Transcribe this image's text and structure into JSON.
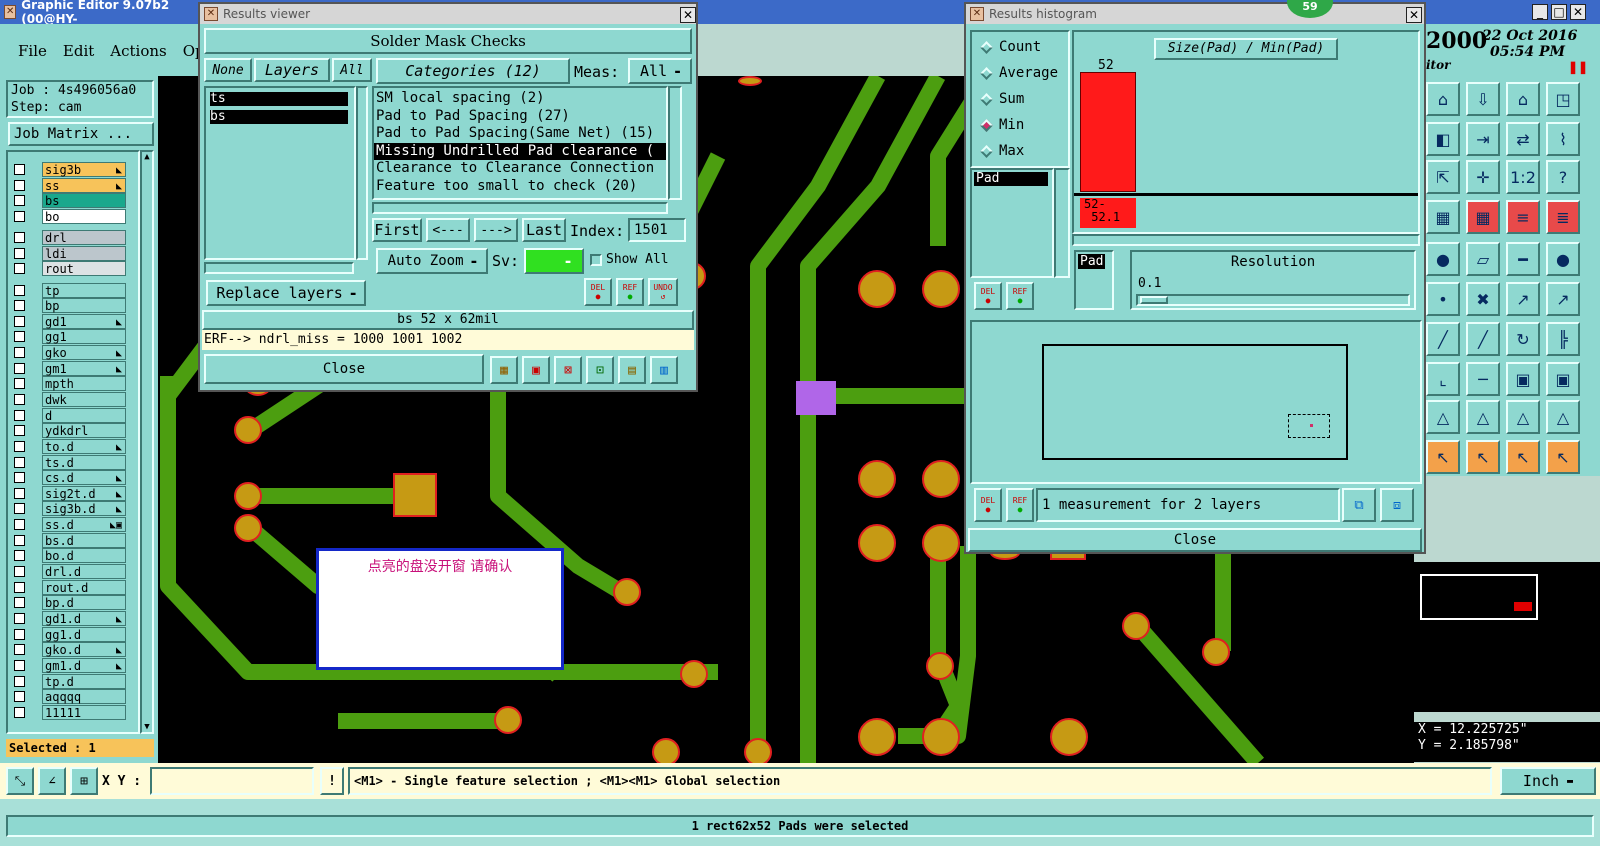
{
  "app": {
    "title": "Graphic Editor 9.07b2 (00@HY-",
    "menu": [
      "File",
      "Edit",
      "Actions",
      "Optio"
    ],
    "date_year": "2000",
    "date": "22 Oct 2016",
    "time": "05:54 PM",
    "date_sub": "itor",
    "badge": "59"
  },
  "job": {
    "job": "Job : 4s496056a0",
    "step": "Step: cam",
    "matrix_btn": "Job Matrix ...",
    "selected": "Selected : 1"
  },
  "layers": [
    {
      "name": "sig3b",
      "color": "#f7c35a",
      "mark": "◣"
    },
    {
      "name": "ss",
      "color": "#f7c35a",
      "mark": "◣"
    },
    {
      "name": "bs",
      "color": "#1aa88c",
      "mark": ""
    },
    {
      "name": "bo",
      "color": "#ffffff",
      "mark": ""
    },
    {
      "name": "drl",
      "color": "#bcc6cc",
      "mark": ""
    },
    {
      "name": "ldi",
      "color": "#bcc6cc",
      "mark": ""
    },
    {
      "name": "rout",
      "color": "#dde2e4",
      "mark": ""
    },
    {
      "name": "tp",
      "color": "#8ed8d0",
      "mark": ""
    },
    {
      "name": "bp",
      "color": "#8ed8d0",
      "mark": ""
    },
    {
      "name": "gd1",
      "color": "#8ed8d0",
      "mark": "◣"
    },
    {
      "name": "gg1",
      "color": "#8ed8d0",
      "mark": ""
    },
    {
      "name": "gko",
      "color": "#8ed8d0",
      "mark": "◣"
    },
    {
      "name": "gm1",
      "color": "#8ed8d0",
      "mark": "◣"
    },
    {
      "name": "mpth",
      "color": "#8ed8d0",
      "mark": ""
    },
    {
      "name": "dwk",
      "color": "#8ed8d0",
      "mark": ""
    },
    {
      "name": "d",
      "color": "#8ed8d0",
      "mark": ""
    },
    {
      "name": "ydkdrl",
      "color": "#8ed8d0",
      "mark": ""
    },
    {
      "name": "to.d",
      "color": "#8ed8d0",
      "mark": "◣"
    },
    {
      "name": "ts.d",
      "color": "#8ed8d0",
      "mark": ""
    },
    {
      "name": "cs.d",
      "color": "#8ed8d0",
      "mark": "◣"
    },
    {
      "name": "sig2t.d",
      "color": "#8ed8d0",
      "mark": "◣"
    },
    {
      "name": "sig3b.d",
      "color": "#8ed8d0",
      "mark": "◣"
    },
    {
      "name": "ss.d",
      "color": "#8ed8d0",
      "mark": "◣▣"
    },
    {
      "name": "bs.d",
      "color": "#8ed8d0",
      "mark": ""
    },
    {
      "name": "bo.d",
      "color": "#8ed8d0",
      "mark": ""
    },
    {
      "name": "drl.d",
      "color": "#8ed8d0",
      "mark": ""
    },
    {
      "name": "rout.d",
      "color": "#8ed8d0",
      "mark": ""
    },
    {
      "name": "bp.d",
      "color": "#8ed8d0",
      "mark": ""
    },
    {
      "name": "gd1.d",
      "color": "#8ed8d0",
      "mark": "◣"
    },
    {
      "name": "gg1.d",
      "color": "#8ed8d0",
      "mark": ""
    },
    {
      "name": "gko.d",
      "color": "#8ed8d0",
      "mark": "◣"
    },
    {
      "name": "gm1.d",
      "color": "#8ed8d0",
      "mark": "◣"
    },
    {
      "name": "tp.d",
      "color": "#8ed8d0",
      "mark": ""
    },
    {
      "name": "aqqqq",
      "color": "#8ed8d0",
      "mark": ""
    },
    {
      "name": "11111",
      "color": "#8ed8d0",
      "mark": ""
    }
  ],
  "results_viewer": {
    "window_title": "Results viewer",
    "heading": "Solder Mask Checks",
    "btn_none": "None",
    "btn_layers": "Layers",
    "btn_all": "All",
    "layer_list": [
      "ts",
      "bs"
    ],
    "categories_label": "Categories (12)",
    "meas_label": "Meas:",
    "meas_value": "All",
    "categories": [
      "SM local spacing (2)",
      "Pad to Pad Spacing (27)",
      "Pad to Pad Spacing(Same Net) (15)",
      "Missing Undrilled Pad clearance (",
      "Clearance to Clearance Connection",
      "Feature too small to check (20)"
    ],
    "selected_category": 3,
    "nav": {
      "first": "First",
      "prev": "<---",
      "next": "--->",
      "last": "Last",
      "index_label": "Index:",
      "index_value": "1501"
    },
    "auto_zoom": "Auto Zoom",
    "sv_label": "Sv:",
    "show_all": "Show All",
    "replace_layers": "Replace layers",
    "del": "DEL",
    "ref": "REF",
    "undo": "UNDO",
    "feature": "bs 52 x 62mil",
    "erf": "ERF--> ndrl_miss = 1000 1001 1002",
    "close": "Close"
  },
  "histogram": {
    "window_title": "Results histogram",
    "options": [
      "Count",
      "Average",
      "Sum",
      "Min",
      "Max"
    ],
    "selected_option": "Min",
    "attribute": "Pad",
    "formula": "Size(Pad) / Min(Pad)",
    "bar_value": "52",
    "bar_range": "52-\n 52.1",
    "resolution_label": "Resolution",
    "resolution_value": "0.1",
    "resolution_side": "Pad",
    "del": "DEL",
    "ref": "REF",
    "measurement": "1 measurement for 2 layers",
    "close": "Close"
  },
  "canvas": {
    "note": "点亮的盘没开窗 请确认"
  },
  "status": {
    "xy_label": "X Y :",
    "xy_value": "",
    "hint": "<M1> - Single feature selection ; <M1><M1> Global selection",
    "units": "Inch",
    "message": "1 rect62x52 Pads were selected",
    "coord_x": "X = 12.225725\"",
    "coord_y": "Y = 2.185798\""
  },
  "colors": {
    "panel": "#8ed8d0",
    "canvas": "#000000",
    "trace": "#4c9e10",
    "pad": "#c69a14",
    "pad_outline": "#e02020",
    "highlight_pad": "#b066e8",
    "hist_bar": "#ff1a1a"
  },
  "tools": [
    "home-icon",
    "move-icon",
    "house-icon",
    "frame-icon",
    "split-icon",
    "arrow-in-icon",
    "swap-icon",
    "zigzag-icon",
    "resize-icon",
    "expand-icon",
    "ratio-icon",
    "help-icon",
    "ruler-grid-icon",
    "grid-icon",
    "traffic-icon",
    "traffic2-icon",
    "drill-icon",
    "pen-icon",
    "ruler-icon",
    "dot-icon",
    "node-icon",
    "cross-icon",
    "arrow-diag-icon",
    "arrow-diag2-icon",
    "slash-icon",
    "slash2-icon",
    "rotate-icon",
    "bracket-icon",
    "corner-icon",
    "dash-icon",
    "box-icon",
    "snap-icon",
    "tri-icon",
    "tri2-icon",
    "tri3-icon",
    "tri4-icon",
    "pointer-icon",
    "pointer2-icon",
    "pointer3-icon",
    "pointer4-icon"
  ],
  "tool_glyphs": [
    "⌂",
    "⇩",
    "⌂",
    "◳",
    "◧",
    "⇥",
    "⇄",
    "⌇",
    "⇱",
    "✛",
    "1:2",
    "?",
    "▦",
    "▦",
    "≡",
    "≣",
    "●",
    "▱",
    "━",
    "●",
    "•",
    "✖",
    "↗",
    "↗",
    "╱",
    "╱",
    "↻",
    "╠",
    "⌞",
    "─",
    "▣",
    "▣",
    "△",
    "△",
    "△",
    "△",
    "↖",
    "↖",
    "↖",
    "↖"
  ]
}
